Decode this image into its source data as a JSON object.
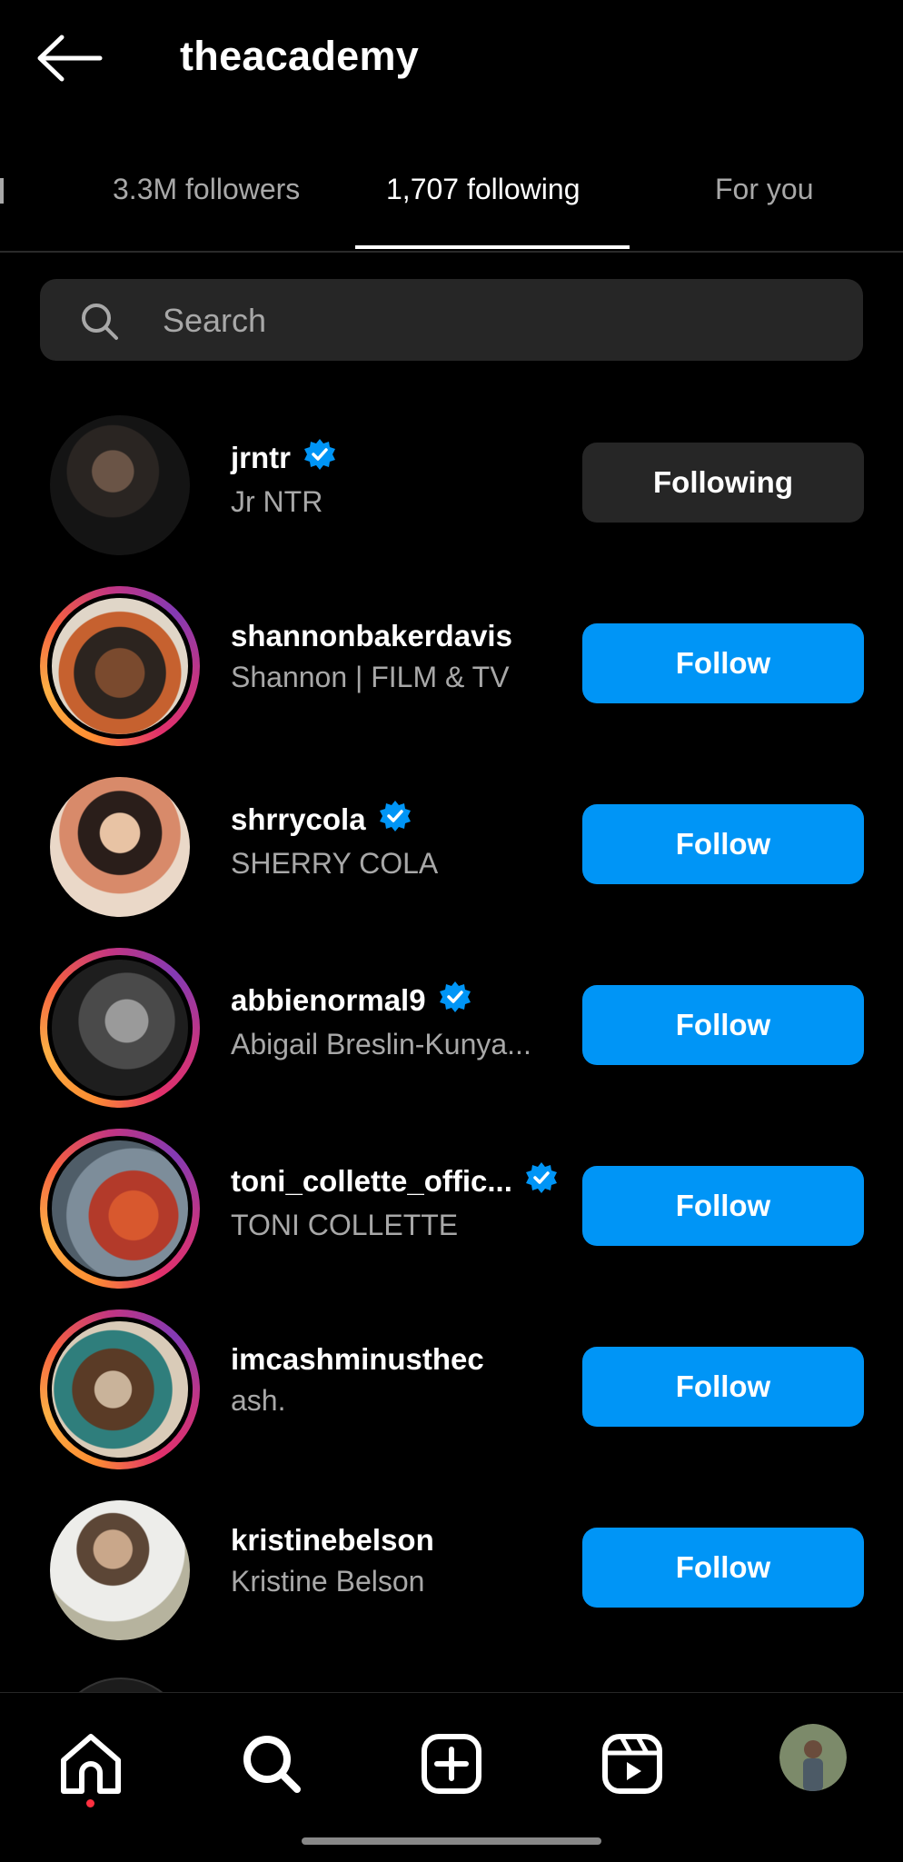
{
  "header": {
    "title": "theacademy"
  },
  "tabs": [
    {
      "label": "3.3M followers"
    },
    {
      "label": "1,707 following"
    },
    {
      "label": "For you"
    }
  ],
  "search": {
    "placeholder": "Search"
  },
  "accounts": [
    {
      "username": "jrntr",
      "full_name": "Jr NTR",
      "verified": true,
      "story_ring": false,
      "button": "Following"
    },
    {
      "username": "shannonbakerdavis",
      "full_name": "Shannon | FILM & TV",
      "verified": false,
      "story_ring": true,
      "button": "Follow"
    },
    {
      "username": "shrrycola",
      "full_name": "SHERRY COLA",
      "verified": true,
      "story_ring": false,
      "button": "Follow"
    },
    {
      "username": "abbienormal9",
      "full_name": "Abigail Breslin-Kunya...",
      "verified": true,
      "story_ring": true,
      "button": "Follow"
    },
    {
      "username": "toni_collette_offic...",
      "full_name": "TONI COLLETTE",
      "verified": true,
      "story_ring": true,
      "button": "Follow"
    },
    {
      "username": "imcashminusthec",
      "full_name": "ash.",
      "verified": false,
      "story_ring": true,
      "button": "Follow"
    },
    {
      "username": "kristinebelson",
      "full_name": "Kristine Belson",
      "verified": false,
      "story_ring": false,
      "button": "Follow"
    }
  ],
  "bottom_nav": [
    {
      "icon": "home-icon"
    },
    {
      "icon": "search-icon"
    },
    {
      "icon": "create-icon"
    },
    {
      "icon": "reels-icon"
    },
    {
      "icon": "profile-avatar"
    }
  ],
  "colors": {
    "accent": "#0095f6",
    "background": "#000000",
    "secondary_button": "#262626",
    "muted_text": "#a8a8a8",
    "notification_dot": "#ff3040"
  }
}
